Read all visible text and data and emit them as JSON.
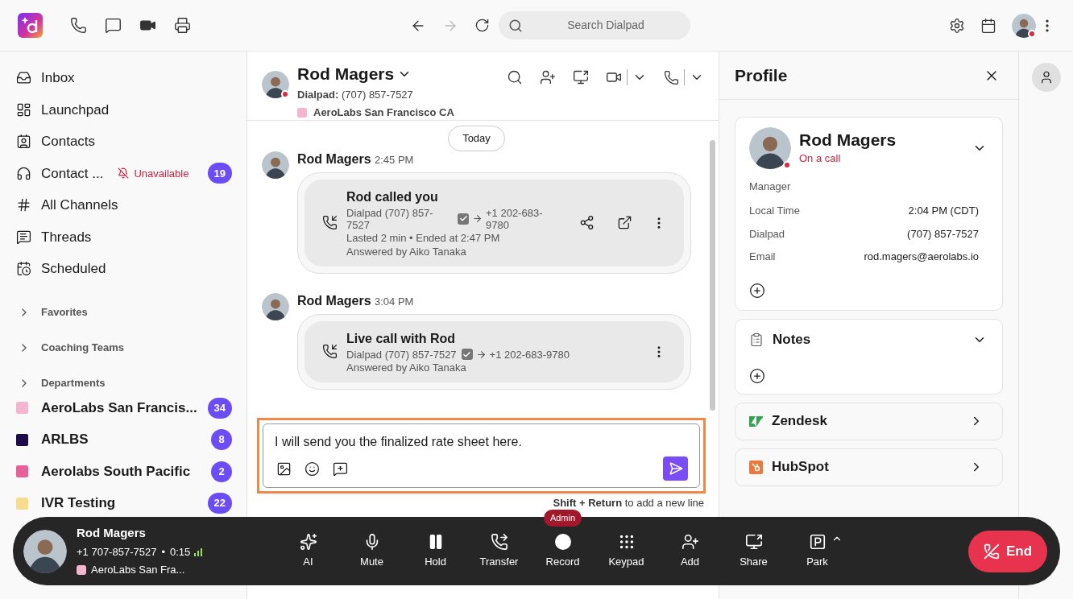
{
  "topbar": {
    "search": {
      "placeholder": "Search Dialpad"
    }
  },
  "sidebar": {
    "items": [
      {
        "label": "Inbox"
      },
      {
        "label": "Launchpad"
      },
      {
        "label": "Contacts"
      },
      {
        "label": "Contact ...",
        "status": "Unavailable",
        "badge": "19"
      },
      {
        "label": "All Channels"
      },
      {
        "label": "Threads"
      },
      {
        "label": "Scheduled"
      }
    ],
    "sections": [
      {
        "label": "Favorites",
        "expanded": false
      },
      {
        "label": "Coaching Teams",
        "expanded": false
      },
      {
        "label": "Departments",
        "expanded": false
      }
    ],
    "departments": [
      {
        "label": "AeroLabs San Francis...",
        "color": "#f4b6cf",
        "badge": "34"
      },
      {
        "label": "ARLBS",
        "color": "#1c0a4a",
        "badge": "8"
      },
      {
        "label": "Aerolabs South Pacific",
        "color": "#e8609a",
        "badge": "2"
      },
      {
        "label": "IVR Testing",
        "color": "#f7dc8e",
        "badge": "22"
      }
    ]
  },
  "conversation": {
    "name": "Rod Magers",
    "channel_label": "Dialpad:",
    "number": "(707) 857-7527",
    "department": {
      "label": "AeroLabs San Francisco CA",
      "color": "#f4b6cf"
    },
    "date_chip": "Today",
    "messages": [
      {
        "sender": "Rod Magers",
        "time": "2:45 PM",
        "title": "Rod called you",
        "from": "Dialpad (707) 857-7527",
        "to": "+1 202-683-9780",
        "details": [
          "Lasted 2 min • Ended at 2:47 PM",
          "Answered by Aiko Tanaka"
        ],
        "wrap": true,
        "share": true
      },
      {
        "sender": "Rod Magers",
        "time": "3:04 PM",
        "title": "Live call with Rod",
        "from": "Dialpad (707) 857-7527",
        "to": "+1 202-683-9780",
        "details": [
          "Answered by Aiko Tanaka"
        ],
        "wrap": false,
        "share": false
      }
    ],
    "composer": {
      "value": "I will send you the finalized rate sheet here.",
      "hint": "**Shift + Return** to add a new line"
    }
  },
  "profile": {
    "title": "Profile",
    "name": "Rod Magers",
    "status": "On a call",
    "role": "Manager",
    "fields": [
      {
        "label": "Local Time",
        "value": "2:04 PM (CDT)"
      },
      {
        "label": "Dialpad",
        "value": "(707) 857-7527"
      },
      {
        "label": "Email",
        "value": "rod.magers@aerolabs.io"
      }
    ],
    "sections": [
      {
        "label": "Notes",
        "kind": "notes"
      },
      {
        "label": "Zendesk",
        "kind": "zendesk"
      },
      {
        "label": "HubSpot",
        "kind": "hubspot"
      }
    ]
  },
  "call_bar": {
    "name": "Rod Magers",
    "number": "+1 707-857-7527",
    "separator": "•",
    "duration": "0:15",
    "department": {
      "label": "AeroLabs San Fra...",
      "color": "#f4b6cf"
    },
    "controls": [
      {
        "label": "AI",
        "kind": "ai"
      },
      {
        "label": "Mute",
        "kind": "mute"
      },
      {
        "label": "Hold",
        "kind": "hold"
      },
      {
        "label": "Transfer",
        "kind": "transfer"
      },
      {
        "label": "Record",
        "kind": "record",
        "badge": "Admin"
      },
      {
        "label": "Keypad",
        "kind": "keypad"
      },
      {
        "label": "Add",
        "kind": "add"
      },
      {
        "label": "Share",
        "kind": "share"
      },
      {
        "label": "Park",
        "kind": "park"
      }
    ],
    "end": "End"
  }
}
